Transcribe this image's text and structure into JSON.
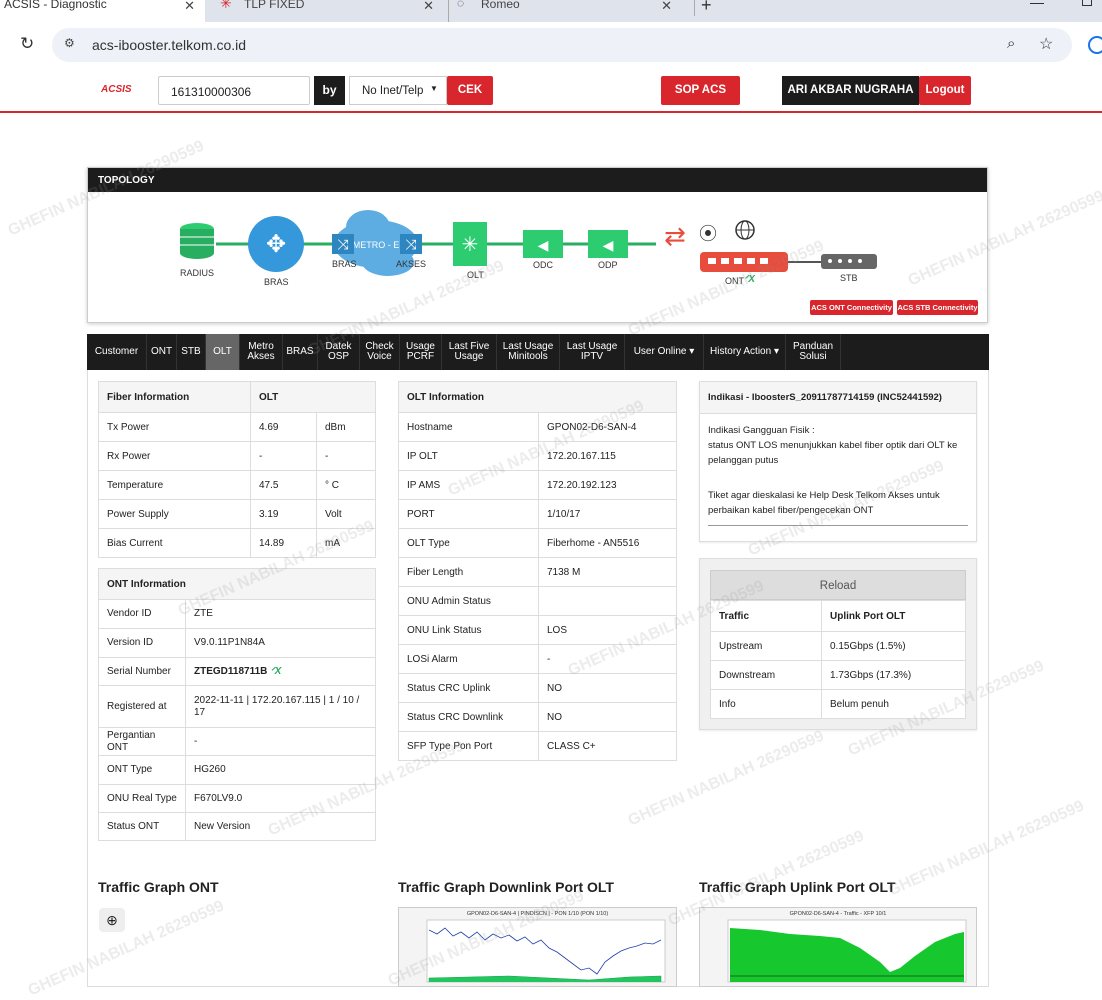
{
  "browser": {
    "tabs": [
      {
        "title": "ACSIS - Diagnostic"
      },
      {
        "title": "TLP FIXED"
      },
      {
        "title": "Romeo"
      }
    ],
    "url": "acs-ibooster.telkom.co.id",
    "new_tab": "+"
  },
  "header": {
    "logo": "ACSIS",
    "search_value": "161310000306",
    "by_label": "by",
    "select_value": "No Inet/Telp",
    "cek": "CEK",
    "sop": "SOP ACS",
    "user": "ARI AKBAR NUGRAHA",
    "logout": "Logout"
  },
  "topology": {
    "title": "TOPOLOGY",
    "nodes": {
      "radius": "RADIUS",
      "bras": "BRAS",
      "bras2": "BRAS",
      "metro": "METRO-E",
      "akses": "AKSES",
      "olt": "OLT",
      "odc": "ODC",
      "odp": "ODP",
      "ont": "ONT",
      "stb": "STB"
    },
    "btn_ont": "ACS ONT Connectivity",
    "btn_stb": "ACS STB Connectivity"
  },
  "nav": [
    "Customer",
    "ONT",
    "STB",
    "OLT",
    "Metro\nAkses",
    "BRAS",
    "Datek\nOSP",
    "Check\nVoice",
    "Usage\nPCRF",
    "Last Five\nUsage",
    "Last Usage\nMinitools",
    "Last Usage\nIPTV",
    "User Online ▾",
    "History Action ▾",
    "Panduan\nSolusi"
  ],
  "fiber": {
    "h1": "Fiber Information",
    "h2": "OLT",
    "rows": [
      [
        "Tx Power",
        "4.69",
        "dBm"
      ],
      [
        "Rx Power",
        "-",
        "-"
      ],
      [
        "Temperature",
        "47.5",
        "° C"
      ],
      [
        "Power Supply",
        "3.19",
        "Volt"
      ],
      [
        "Bias Current",
        "14.89",
        "mA"
      ]
    ]
  },
  "ont_info": {
    "h": "ONT Information",
    "rows": [
      [
        "Vendor ID",
        "ZTE"
      ],
      [
        "Version ID",
        "V9.0.11P1N84A"
      ],
      [
        "Serial Number",
        "ZTEGD118711B"
      ],
      [
        "Registered at",
        "2022-11-11 | 172.20.167.115 | 1 / 10 / 17"
      ],
      [
        "Pergantian ONT",
        "-"
      ],
      [
        "ONT Type",
        "HG260"
      ],
      [
        "ONU Real Type",
        "F670LV9.0"
      ],
      [
        "Status ONT",
        "New Version"
      ]
    ]
  },
  "olt_info": {
    "h": "OLT Information",
    "rows": [
      [
        "Hostname",
        "GPON02-D6-SAN-4"
      ],
      [
        "IP OLT",
        "172.20.167.115"
      ],
      [
        "IP AMS",
        "172.20.192.123"
      ],
      [
        "PORT",
        "1/10/17"
      ],
      [
        "OLT Type",
        "Fiberhome - AN5516"
      ],
      [
        "Fiber Length",
        "7138 M"
      ],
      [
        "ONU Admin Status",
        ""
      ],
      [
        "ONU Link Status",
        "LOS"
      ],
      [
        "LOSi Alarm",
        "-"
      ],
      [
        "Status CRC Uplink",
        "NO"
      ],
      [
        "Status CRC Downlink",
        "NO"
      ],
      [
        "SFP Type Pon Port",
        "CLASS C+"
      ]
    ]
  },
  "indikasi": {
    "title": "Indikasi - IboosterS_20911787714159 (INC52441592)",
    "line1": "Indikasi Gangguan Fisik :",
    "line2": "status ONT LOS menunjukkan kabel fiber optik dari OLT ke pelanggan putus",
    "line3": "Tiket agar dieskalasi ke Help Desk Telkom Akses untuk perbaikan kabel fiber/pengecekan ONT"
  },
  "traffic": {
    "reload": "Reload",
    "h1": "Traffic",
    "h2": "Uplink Port OLT",
    "rows": [
      [
        "Upstream",
        "0.15Gbps (1.5%)"
      ],
      [
        "Downstream",
        "1.73Gbps (17.3%)"
      ],
      [
        "Info",
        "Belum penuh"
      ]
    ]
  },
  "graphs": {
    "ont": "Traffic Graph ONT",
    "down": "Traffic Graph Downlink Port OLT",
    "up": "Traffic Graph Uplink Port OLT",
    "down_caption": "GPON02-D6-SAN-4 | PINDISCN | - PON 1/10 (PON 1/10)",
    "up_caption": "GPON02-D6-SAN-4 - Traffic - XFP 10/1"
  },
  "watermark": "GHEFIN NABILAH 26290599"
}
